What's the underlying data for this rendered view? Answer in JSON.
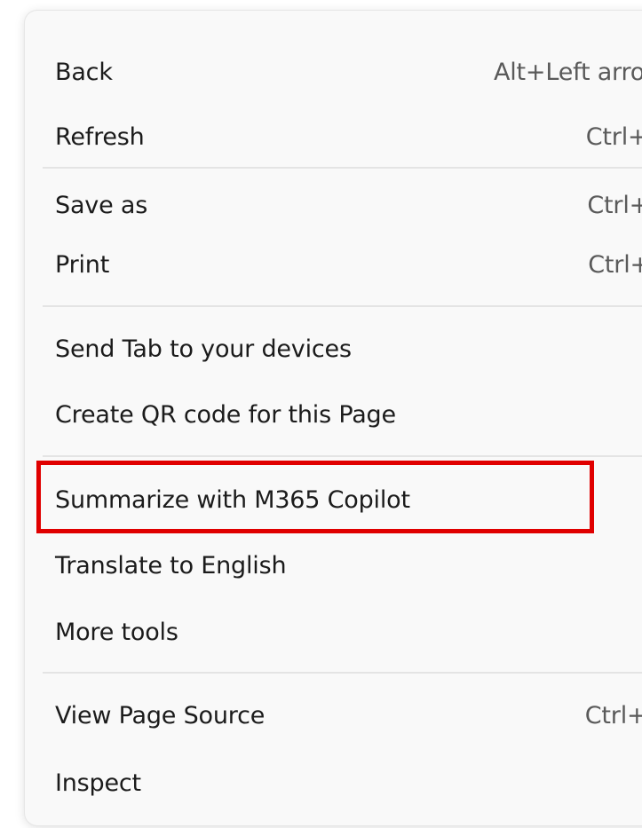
{
  "menu": {
    "items": [
      {
        "label": "Back",
        "shortcut": "Alt+Left arrow"
      },
      {
        "label": "Refresh",
        "shortcut": "Ctrl+R"
      },
      {
        "label": "Save as",
        "shortcut": "Ctrl+S"
      },
      {
        "label": "Print",
        "shortcut": "Ctrl+P"
      },
      {
        "label": "Send Tab to your devices",
        "shortcut": ""
      },
      {
        "label": "Create QR code for this Page",
        "shortcut": ""
      },
      {
        "label": "Summarize with M365 Copilot",
        "shortcut": ""
      },
      {
        "label": "Translate to English",
        "shortcut": ""
      },
      {
        "label": "More tools",
        "shortcut": "",
        "submenu_icon": "chevron-right-icon"
      },
      {
        "label": "View Page Source",
        "shortcut": "Ctrl+U"
      },
      {
        "label": "Inspect",
        "shortcut": ""
      }
    ]
  },
  "highlight": {
    "target": "Summarize with M365 Copilot",
    "color": "#e00000"
  }
}
